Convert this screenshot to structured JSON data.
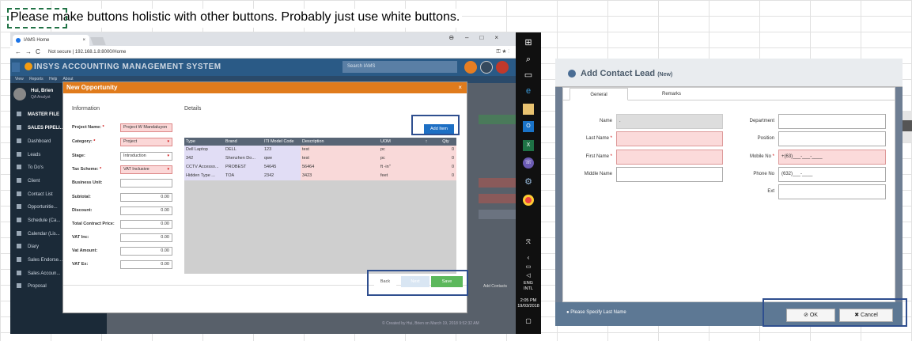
{
  "note": "Please make buttons holistic with other buttons. Probably just use white buttons.",
  "browser": {
    "tab_title": "IAMS Home",
    "url_prefix": "Not secure",
    "url": "192.168.1.8:8000/Home"
  },
  "app": {
    "title": "INSYS ACCOUNTING MANAGEMENT SYSTEM",
    "search_placeholder": "Search IAMS",
    "submenu": [
      "View",
      "Reports",
      "Help",
      "About"
    ],
    "user_name": "Hui, Brien",
    "user_role": "QA Analyst",
    "sidebar": [
      {
        "label": "MASTER FILE",
        "header": true
      },
      {
        "label": "SALES PIPELI...",
        "header": true
      },
      {
        "label": "Dashboard"
      },
      {
        "label": "Leads"
      },
      {
        "label": "To Do's"
      },
      {
        "label": "Client"
      },
      {
        "label": "Contact List"
      },
      {
        "label": "Opportunitie..."
      },
      {
        "label": "Schedule (Ca..."
      },
      {
        "label": "Calendar (Lis..."
      },
      {
        "label": "Diary"
      },
      {
        "label": "Sales Endorse..."
      },
      {
        "label": "Sales Accoun..."
      },
      {
        "label": "Proposal"
      }
    ],
    "footer": "© Created by Hui, Brien on March 19, 2018 9:52:32 AM",
    "add_contacts": "Add Contacts"
  },
  "opportunity_modal": {
    "title": "New Opportunity",
    "close": "×",
    "info_heading": "Information",
    "details_heading": "Details",
    "fields": [
      {
        "label": "Project Name:",
        "required": true,
        "value": "Project W Mandaluyon",
        "style": "pink"
      },
      {
        "label": "Category:",
        "required": true,
        "value": "Project",
        "style": "pink",
        "dropdown": true
      },
      {
        "label": "Stage:",
        "required": false,
        "value": "Introduction",
        "style": "",
        "dropdown": true
      },
      {
        "label": "Tax Scheme:",
        "required": true,
        "value": "VAT Inclusive",
        "style": "pink",
        "dropdown": true
      },
      {
        "label": "Business Unit:",
        "required": false,
        "value": "",
        "style": ""
      },
      {
        "label": "Subtotal:",
        "required": false,
        "value": "0.00",
        "style": "num"
      },
      {
        "label": "Discount:",
        "required": false,
        "value": "0.00",
        "style": "num"
      },
      {
        "label": "Total Contract Price:",
        "required": false,
        "value": "0.00",
        "style": "num"
      },
      {
        "label": "VAT Inc:",
        "required": false,
        "value": "0.00",
        "style": "num"
      },
      {
        "label": "Vat Amount:",
        "required": false,
        "value": "0.00",
        "style": "num"
      },
      {
        "label": "VAT Ex:",
        "required": false,
        "value": "0.00",
        "style": "num"
      }
    ],
    "add_item": "Add Item",
    "table": {
      "columns": [
        "Type",
        "Brand",
        "ITI Model Code",
        "Description",
        "UOM",
        "↑",
        "Qty"
      ],
      "rows": [
        [
          "Dell Laptop",
          "DELL",
          "123",
          "test",
          "pc",
          "",
          "0"
        ],
        [
          "342",
          "Shenzhen Do...",
          "qwe",
          "test",
          "pc",
          "",
          "0"
        ],
        [
          "CCTV Accesso...",
          "PROBEST",
          "54645",
          "56464",
          "ft -in\"",
          "",
          "0"
        ],
        [
          "Hidden Type ...",
          "TOA",
          "2342",
          "3423",
          "feet",
          "",
          "0"
        ]
      ]
    },
    "buttons": {
      "back": "Back",
      "next": "Next",
      "save": "Save"
    }
  },
  "taskbar": {
    "lang": "ENG",
    "layout": "INTL",
    "time": "2:05 PM",
    "date": "19/03/2018"
  },
  "contact_dialog": {
    "title": "Add Contact Lead",
    "title_badge": "(New)",
    "tabs": [
      "General",
      "Remarks"
    ],
    "left_fields": [
      {
        "label": "Name",
        "required": false,
        "value": ".",
        "style": "grey"
      },
      {
        "label": "Last Name",
        "required": true,
        "value": "",
        "style": "pink"
      },
      {
        "label": "First Name",
        "required": true,
        "value": "",
        "style": "pink"
      },
      {
        "label": "Middle Name",
        "required": false,
        "value": "",
        "style": ""
      }
    ],
    "right_fields": [
      {
        "label": "Department",
        "required": false,
        "value": "",
        "style": ""
      },
      {
        "label": "Position",
        "required": false,
        "value": "",
        "style": ""
      },
      {
        "label": "Mobile No",
        "required": true,
        "value": "+(63)___-___-____",
        "style": "pink"
      },
      {
        "label": "Phone No",
        "required": false,
        "value": "(632)___-____",
        "style": ""
      },
      {
        "label": "Ext",
        "required": false,
        "value": "",
        "style": ""
      }
    ],
    "status": "Please Specify Last Name",
    "ok": "OK",
    "cancel": "Cancel"
  },
  "colors": {
    "modal_header": "#e07b1c",
    "add_item": "#1d6fc4",
    "save": "#5cb85c",
    "highlight": "#2f4f8f",
    "required_field": "#fbd7d7"
  }
}
